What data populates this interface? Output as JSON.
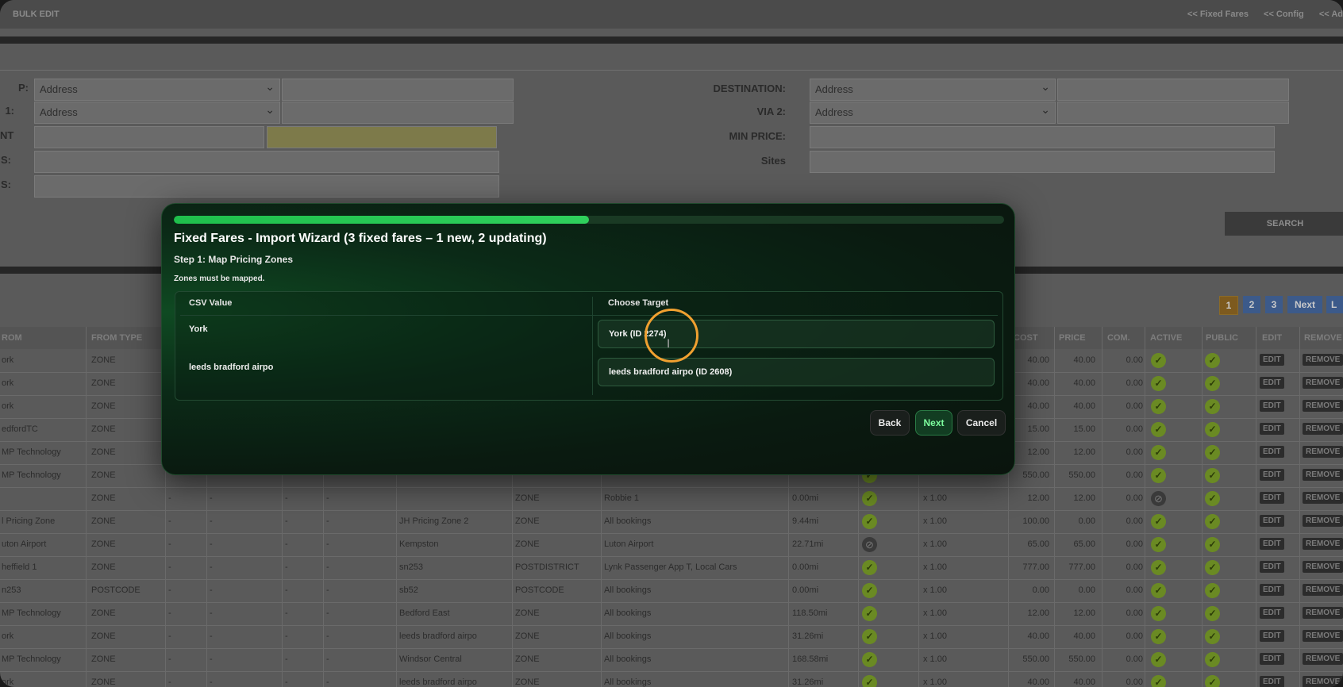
{
  "header": {
    "title": "BULK EDIT",
    "links": [
      "<< Fixed Fares",
      "<< Config",
      "<< Ad"
    ]
  },
  "filters": {
    "left": [
      {
        "label": "P:",
        "select": "Address",
        "text": ""
      },
      {
        "label": "1:",
        "select": "Address",
        "text": ""
      },
      {
        "label": "NT",
        "select": "",
        "text": ""
      },
      {
        "label": "S:",
        "select": "",
        "text": ""
      },
      {
        "label": "S:",
        "select": "",
        "text": ""
      }
    ],
    "right": [
      {
        "label": "DESTINATION:",
        "select": "Address",
        "text": ""
      },
      {
        "label": "VIA 2:",
        "select": "Address",
        "text": ""
      },
      {
        "label": "MIN PRICE:",
        "select": "",
        "text": ""
      },
      {
        "label": "Sites",
        "select": "",
        "text": ""
      }
    ],
    "search_label": "SEARCH"
  },
  "pager": {
    "pages": [
      "1",
      "2",
      "3"
    ],
    "next": "Next",
    "last": "L"
  },
  "table": {
    "headers": [
      "ROM",
      "FROM TYPE",
      "COST",
      "PRICE",
      "COM.",
      "ACTIVE",
      "PUBLIC",
      "EDIT",
      "REMOVE"
    ],
    "edit_label": "EDIT",
    "remove_label": "REMOVE",
    "rows": [
      {
        "from": "ork",
        "from_type": "ZONE",
        "a": "",
        "b": "",
        "c": "",
        "d": "",
        "to": "",
        "to_type": "",
        "site": "",
        "dist": "",
        "mult": "",
        "cost": "40.00",
        "price": "40.00",
        "com": "0.00",
        "active": true
      },
      {
        "from": "ork",
        "from_type": "ZONE",
        "a": "",
        "b": "",
        "c": "",
        "d": "",
        "to": "",
        "to_type": "",
        "site": "",
        "dist": "",
        "mult": "",
        "cost": "40.00",
        "price": "40.00",
        "com": "0.00",
        "active": true
      },
      {
        "from": "ork",
        "from_type": "ZONE",
        "a": "",
        "b": "",
        "c": "",
        "d": "",
        "to": "",
        "to_type": "",
        "site": "",
        "dist": "",
        "mult": "",
        "cost": "40.00",
        "price": "40.00",
        "com": "0.00",
        "active": true
      },
      {
        "from": "edfordTC",
        "from_type": "ZONE",
        "a": "",
        "b": "",
        "c": "",
        "d": "",
        "to": "",
        "to_type": "",
        "site": "",
        "dist": "",
        "mult": "",
        "cost": "15.00",
        "price": "15.00",
        "com": "0.00",
        "active": true
      },
      {
        "from": "MP Technology",
        "from_type": "ZONE",
        "a": "",
        "b": "",
        "c": "",
        "d": "",
        "to": "",
        "to_type": "",
        "site": "",
        "dist": "",
        "mult": "",
        "cost": "12.00",
        "price": "12.00",
        "com": "0.00",
        "active": true
      },
      {
        "from": "MP Technology",
        "from_type": "ZONE",
        "a": "",
        "b": "",
        "c": "",
        "d": "",
        "to": "",
        "to_type": "",
        "site": "",
        "dist": "",
        "mult": "",
        "cost": "550.00",
        "price": "550.00",
        "com": "0.00",
        "active": true
      },
      {
        "from": "",
        "from_type": "ZONE",
        "a": "-",
        "b": "-",
        "c": "-",
        "d": "-",
        "to": "",
        "to_type": "ZONE",
        "site": "Robbie 1",
        "dist": "0.00mi",
        "mult": "x 1.00",
        "cost": "12.00",
        "price": "12.00",
        "com": "0.00",
        "active": false
      },
      {
        "from": "l Pricing Zone",
        "from_type": "ZONE",
        "a": "-",
        "b": "-",
        "c": "-",
        "d": "-",
        "to": "JH Pricing Zone 2",
        "to_type": "ZONE",
        "site": "All bookings",
        "dist": "9.44mi",
        "mult": "x 1.00",
        "cost": "100.00",
        "price": "0.00",
        "com": "0.00",
        "active": true
      },
      {
        "from": "uton Airport",
        "from_type": "ZONE",
        "a": "-",
        "b": "-",
        "c": "-",
        "d": "-",
        "to": "Kempston",
        "to_type": "ZONE",
        "site": "Luton Airport",
        "dist": "22.71mi",
        "mult": "x 1.00",
        "cost": "65.00",
        "price": "65.00",
        "com": "0.00",
        "active": true
      },
      {
        "from": "heffield 1",
        "from_type": "ZONE",
        "a": "-",
        "b": "-",
        "c": "-",
        "d": "-",
        "to": "sn253",
        "to_type": "POSTDISTRICT",
        "site": "Lynk Passenger App T, Local Cars",
        "dist": "0.00mi",
        "mult": "x 1.00",
        "cost": "777.00",
        "price": "777.00",
        "com": "0.00",
        "active": true
      },
      {
        "from": "n253",
        "from_type": "POSTCODE",
        "a": "-",
        "b": "-",
        "c": "-",
        "d": "-",
        "to": "sb52",
        "to_type": "POSTCODE",
        "site": "All bookings",
        "dist": "0.00mi",
        "mult": "x 1.00",
        "cost": "0.00",
        "price": "0.00",
        "com": "0.00",
        "active": true
      },
      {
        "from": "MP Technology",
        "from_type": "ZONE",
        "a": "-",
        "b": "-",
        "c": "-",
        "d": "-",
        "to": "Bedford East",
        "to_type": "ZONE",
        "site": "All bookings",
        "dist": "118.50mi",
        "mult": "x 1.00",
        "cost": "12.00",
        "price": "12.00",
        "com": "0.00",
        "active": true
      },
      {
        "from": "ork",
        "from_type": "ZONE",
        "a": "-",
        "b": "-",
        "c": "-",
        "d": "-",
        "to": "leeds bradford airpo",
        "to_type": "ZONE",
        "site": "All bookings",
        "dist": "31.26mi",
        "mult": "x 1.00",
        "cost": "40.00",
        "price": "40.00",
        "com": "0.00",
        "active": true
      },
      {
        "from": "MP Technology",
        "from_type": "ZONE",
        "a": "-",
        "b": "-",
        "c": "-",
        "d": "-",
        "to": "Windsor Central",
        "to_type": "ZONE",
        "site": "All bookings",
        "dist": "168.58mi",
        "mult": "x 1.00",
        "cost": "550.00",
        "price": "550.00",
        "com": "0.00",
        "active": true
      },
      {
        "from": "ork",
        "from_type": "ZONE",
        "a": "-",
        "b": "-",
        "c": "-",
        "d": "-",
        "to": "leeds bradford airpo",
        "to_type": "ZONE",
        "site": "All bookings",
        "dist": "31.26mi",
        "mult": "x 1.00",
        "cost": "40.00",
        "price": "40.00",
        "com": "0.00",
        "active": true
      }
    ],
    "row6_mid_active": false,
    "row8_mid_active": false
  },
  "modal": {
    "progress_percent": 50,
    "title": "Fixed Fares - Import Wizard (3 fixed fares – 1 new, 2 updating)",
    "step": "Step 1: Map Pricing Zones",
    "hint": "Zones must be mapped.",
    "col_csv": "CSV Value",
    "col_target": "Choose Target",
    "mappings": [
      {
        "csv": "York",
        "target": "York (ID 2274)"
      },
      {
        "csv": "leeds bradford airpo",
        "target": "leeds bradford airpo (ID 2608)"
      }
    ],
    "buttons": {
      "back": "Back",
      "next": "Next",
      "cancel": "Cancel"
    }
  },
  "colors": {
    "accent": "#2fd05c",
    "cursor_ring": "#f0a030"
  }
}
